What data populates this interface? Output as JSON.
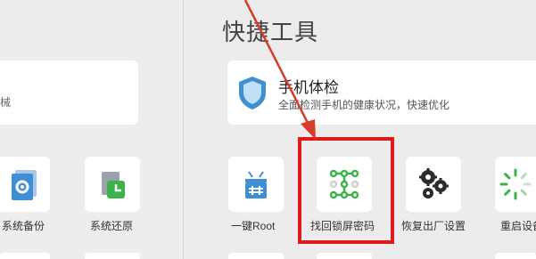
{
  "section": {
    "title": "快捷工具"
  },
  "left_banner": {
    "text": "械"
  },
  "left_tools": [
    {
      "label": "系统备份",
      "icon": "gear-document-icon"
    },
    {
      "label": "系统还原",
      "icon": "clock-restore-icon"
    }
  ],
  "checkup": {
    "title": "手机体检",
    "description": "全面检测手机的健康状况，快速优化",
    "icon": "shield-icon"
  },
  "tools": [
    {
      "label": "一键Root",
      "icon": "android-root-icon"
    },
    {
      "label": "找回锁屏密码",
      "icon": "pattern-lock-icon"
    },
    {
      "label": "恢复出厂设置",
      "icon": "gears-icon"
    },
    {
      "label": "重启设备",
      "icon": "restart-spinner-icon"
    }
  ],
  "colors": {
    "highlight": "#e01a1a",
    "arrow": "#d93a2a",
    "tile_bg": "#ffffff",
    "pane_bg": "#ececec",
    "accent_blue": "#3f8fd6",
    "accent_green": "#3cb34a"
  }
}
